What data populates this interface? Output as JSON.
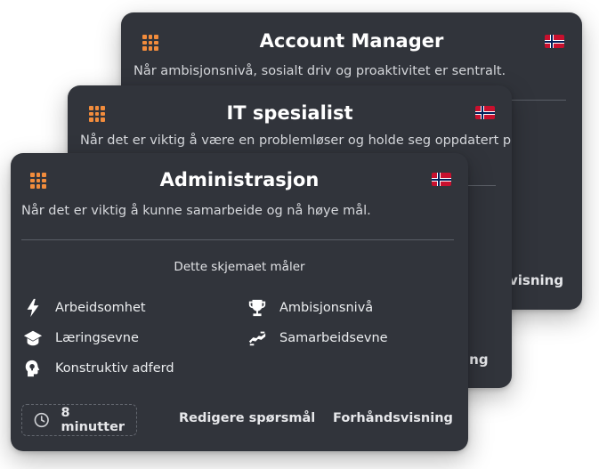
{
  "cards": {
    "account_manager": {
      "title": "Account Manager",
      "description": "Når ambisjonsnivå, sosialt driv og proaktivitet er sentralt.",
      "peek_action": "visning"
    },
    "it_spesialist": {
      "title": "IT spesialist",
      "description": "Når det er viktig å være en problemløser og holde seg oppdatert på",
      "peek_action": "ing"
    },
    "administrasjon": {
      "title": "Administrasjon",
      "description": "Når det er viktig å kunne samarbeide og nå høye mål.",
      "measures_heading": "Dette skjemaet måler",
      "metrics": [
        {
          "label": "Arbeidsomhet",
          "icon": "bolt-icon"
        },
        {
          "label": "Ambisjonsnivå",
          "icon": "trophy-icon"
        },
        {
          "label": "Læringsevne",
          "icon": "graduation-cap-icon"
        },
        {
          "label": "Samarbeidsevne",
          "icon": "handshake-icon"
        },
        {
          "label": "Konstruktiv adferd",
          "icon": "head-lightbulb-icon"
        }
      ],
      "duration": "8 minutter",
      "edit_label": "Redigere spørsmål",
      "preview_label": "Forhåndsvisning"
    }
  },
  "colors": {
    "card_bg": "#31343b",
    "accent": "#f28c3c"
  }
}
